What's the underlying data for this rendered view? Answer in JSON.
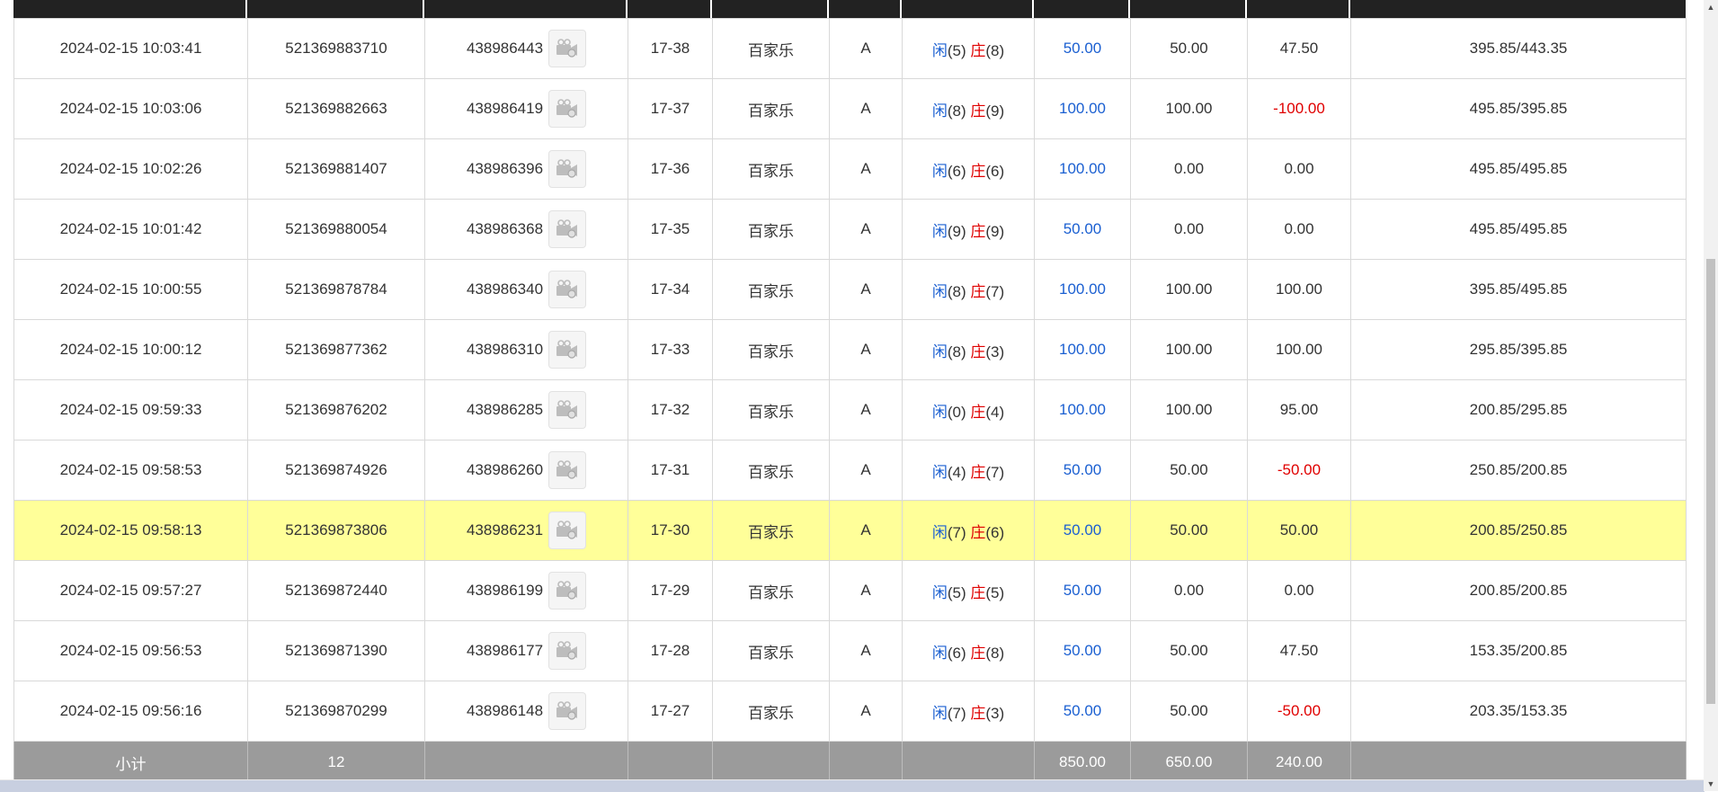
{
  "rows": [
    {
      "time": "2024-02-15 10:03:41",
      "order_id": "521369883710",
      "round_id": "438986443",
      "table_no": "17-38",
      "game": "百家乐",
      "side": "A",
      "player_label": "闲",
      "player_score": "(5)",
      "banker_label": "庄",
      "banker_score": "(8)",
      "bet": "50.00",
      "valid_bet": "50.00",
      "win_loss": "47.50",
      "win_loss_negative": false,
      "balance": "395.85/443.35",
      "highlight": false
    },
    {
      "time": "2024-02-15 10:03:06",
      "order_id": "521369882663",
      "round_id": "438986419",
      "table_no": "17-37",
      "game": "百家乐",
      "side": "A",
      "player_label": "闲",
      "player_score": "(8)",
      "banker_label": "庄",
      "banker_score": "(9)",
      "bet": "100.00",
      "valid_bet": "100.00",
      "win_loss": "-100.00",
      "win_loss_negative": true,
      "balance": "495.85/395.85",
      "highlight": false
    },
    {
      "time": "2024-02-15 10:02:26",
      "order_id": "521369881407",
      "round_id": "438986396",
      "table_no": "17-36",
      "game": "百家乐",
      "side": "A",
      "player_label": "闲",
      "player_score": "(6)",
      "banker_label": "庄",
      "banker_score": "(6)",
      "bet": "100.00",
      "valid_bet": "0.00",
      "win_loss": "0.00",
      "win_loss_negative": false,
      "balance": "495.85/495.85",
      "highlight": false
    },
    {
      "time": "2024-02-15 10:01:42",
      "order_id": "521369880054",
      "round_id": "438986368",
      "table_no": "17-35",
      "game": "百家乐",
      "side": "A",
      "player_label": "闲",
      "player_score": "(9)",
      "banker_label": "庄",
      "banker_score": "(9)",
      "bet": "50.00",
      "valid_bet": "0.00",
      "win_loss": "0.00",
      "win_loss_negative": false,
      "balance": "495.85/495.85",
      "highlight": false
    },
    {
      "time": "2024-02-15 10:00:55",
      "order_id": "521369878784",
      "round_id": "438986340",
      "table_no": "17-34",
      "game": "百家乐",
      "side": "A",
      "player_label": "闲",
      "player_score": "(8)",
      "banker_label": "庄",
      "banker_score": "(7)",
      "bet": "100.00",
      "valid_bet": "100.00",
      "win_loss": "100.00",
      "win_loss_negative": false,
      "balance": "395.85/495.85",
      "highlight": false
    },
    {
      "time": "2024-02-15 10:00:12",
      "order_id": "521369877362",
      "round_id": "438986310",
      "table_no": "17-33",
      "game": "百家乐",
      "side": "A",
      "player_label": "闲",
      "player_score": "(8)",
      "banker_label": "庄",
      "banker_score": "(3)",
      "bet": "100.00",
      "valid_bet": "100.00",
      "win_loss": "100.00",
      "win_loss_negative": false,
      "balance": "295.85/395.85",
      "highlight": false
    },
    {
      "time": "2024-02-15 09:59:33",
      "order_id": "521369876202",
      "round_id": "438986285",
      "table_no": "17-32",
      "game": "百家乐",
      "side": "A",
      "player_label": "闲",
      "player_score": "(0)",
      "banker_label": "庄",
      "banker_score": "(4)",
      "bet": "100.00",
      "valid_bet": "100.00",
      "win_loss": "95.00",
      "win_loss_negative": false,
      "balance": "200.85/295.85",
      "highlight": false
    },
    {
      "time": "2024-02-15 09:58:53",
      "order_id": "521369874926",
      "round_id": "438986260",
      "table_no": "17-31",
      "game": "百家乐",
      "side": "A",
      "player_label": "闲",
      "player_score": "(4)",
      "banker_label": "庄",
      "banker_score": "(7)",
      "bet": "50.00",
      "valid_bet": "50.00",
      "win_loss": "-50.00",
      "win_loss_negative": true,
      "balance": "250.85/200.85",
      "highlight": false
    },
    {
      "time": "2024-02-15 09:58:13",
      "order_id": "521369873806",
      "round_id": "438986231",
      "table_no": "17-30",
      "game": "百家乐",
      "side": "A",
      "player_label": "闲",
      "player_score": "(7)",
      "banker_label": "庄",
      "banker_score": "(6)",
      "bet": "50.00",
      "valid_bet": "50.00",
      "win_loss": "50.00",
      "win_loss_negative": false,
      "balance": "200.85/250.85",
      "highlight": true
    },
    {
      "time": "2024-02-15 09:57:27",
      "order_id": "521369872440",
      "round_id": "438986199",
      "table_no": "17-29",
      "game": "百家乐",
      "side": "A",
      "player_label": "闲",
      "player_score": "(5)",
      "banker_label": "庄",
      "banker_score": "(5)",
      "bet": "50.00",
      "valid_bet": "0.00",
      "win_loss": "0.00",
      "win_loss_negative": false,
      "balance": "200.85/200.85",
      "highlight": false
    },
    {
      "time": "2024-02-15 09:56:53",
      "order_id": "521369871390",
      "round_id": "438986177",
      "table_no": "17-28",
      "game": "百家乐",
      "side": "A",
      "player_label": "闲",
      "player_score": "(6)",
      "banker_label": "庄",
      "banker_score": "(8)",
      "bet": "50.00",
      "valid_bet": "50.00",
      "win_loss": "47.50",
      "win_loss_negative": false,
      "balance": "153.35/200.85",
      "highlight": false
    },
    {
      "time": "2024-02-15 09:56:16",
      "order_id": "521369870299",
      "round_id": "438986148",
      "table_no": "17-27",
      "game": "百家乐",
      "side": "A",
      "player_label": "闲",
      "player_score": "(7)",
      "banker_label": "庄",
      "banker_score": "(3)",
      "bet": "50.00",
      "valid_bet": "50.00",
      "win_loss": "-50.00",
      "win_loss_negative": true,
      "balance": "203.35/153.35",
      "highlight": false
    }
  ],
  "subtotal": {
    "label": "小计",
    "count": "12",
    "bet": "850.00",
    "valid_bet": "650.00",
    "win_loss": "240.00"
  },
  "colors": {
    "player": "#1a5fd1",
    "banker": "#e00000",
    "highlight_row": "#ffff99",
    "subtotal_bg": "#9b9b9b"
  },
  "icons": {
    "round_action": "video-replay-icon",
    "scroll_up": "scroll-up-arrow-icon",
    "scroll_down": "scroll-down-arrow-icon"
  }
}
